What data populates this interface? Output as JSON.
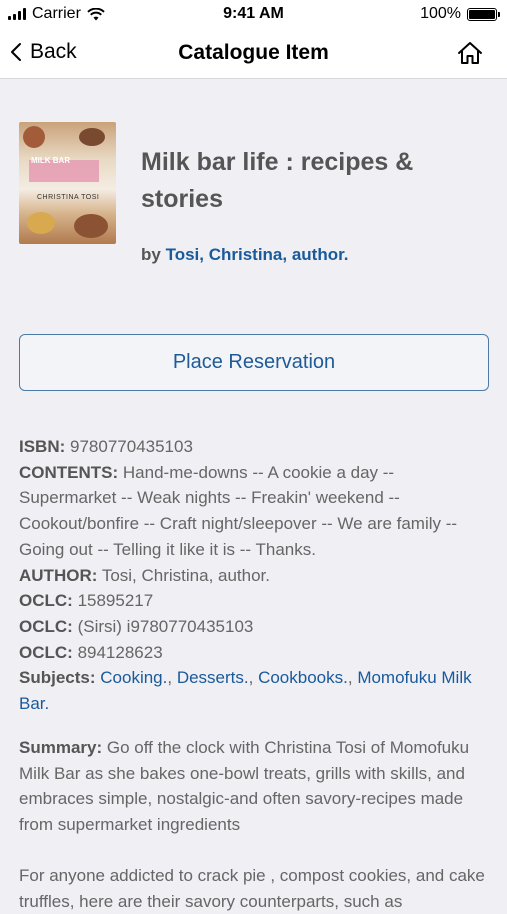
{
  "status_bar": {
    "carrier": "Carrier",
    "time": "9:41 AM",
    "battery": "100%"
  },
  "nav": {
    "back_label": "Back",
    "title": "Catalogue Item"
  },
  "item": {
    "title": "Milk bar life : recipes & stories",
    "by_prefix": "by",
    "author_link": "Tosi, Christina, author.",
    "cover": {
      "title": "MILK BAR",
      "author": "CHRISTINA TOSI"
    }
  },
  "reserve_label": "Place Reservation",
  "details": {
    "isbn_label": "ISBN:",
    "isbn": "9780770435103",
    "contents_label": "CONTENTS:",
    "contents": "Hand-me-downs -- A cookie a day -- Supermarket -- Weak nights -- Freakin' weekend -- Cookout/bonfire -- Craft night/sleepover -- We are family -- Going out -- Telling it like it is -- Thanks.",
    "author_label": "AUTHOR:",
    "author": "Tosi, Christina, author.",
    "oclc_label": "OCLC:",
    "oclc_1": "15895217",
    "oclc_2": "(Sirsi) i9780770435103",
    "oclc_3": "894128623",
    "subjects_label": "Subjects:",
    "subjects": [
      "Cooking.",
      "Desserts.",
      "Cookbooks.",
      "Momofuku Milk Bar."
    ],
    "subject_separator": ", "
  },
  "summary": {
    "label": "Summary:",
    "text": "Go off the clock with Christina Tosi of Momofuku Milk Bar as she bakes one-bowl treats, grills with skills, and embraces simple, nostalgic-and often savory-recipes made from supermarket ingredients",
    "extra": "For anyone addicted to crack pie , compost cookies, and cake truffles, here are their savory counterparts, such as"
  }
}
